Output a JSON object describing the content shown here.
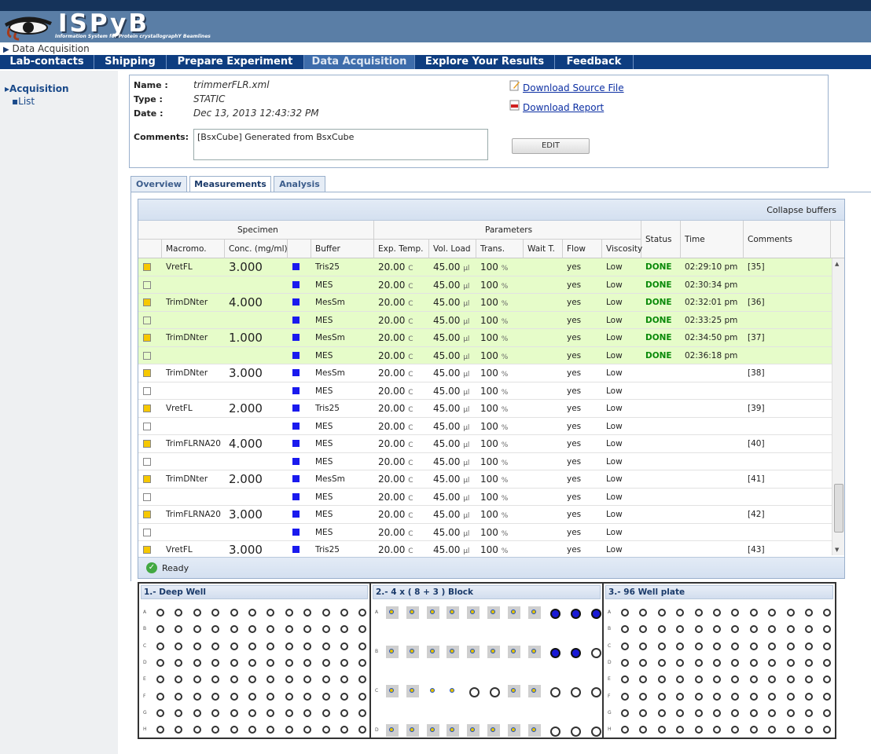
{
  "app": {
    "name": "ISPyB",
    "subtitle": "Information System for Protein crystallographY Beamlines"
  },
  "breadcrumb": "Data Acquisition",
  "nav": [
    "Lab-contacts",
    "Shipping",
    "Prepare Experiment",
    "Data Acquisition",
    "Explore Your Results",
    "Feedback"
  ],
  "nav_active": "Data Acquisition",
  "sidebar": {
    "section": "Acquisition",
    "item": "List"
  },
  "info": {
    "name_label": "Name :",
    "name": "trimmerFLR.xml",
    "type_label": "Type :",
    "type": "STATIC",
    "date_label": "Date :",
    "date": "Dec 13, 2013 12:43:32 PM",
    "comments_label": "Comments:",
    "comments": "[BsxCube] Generated from BsxCube",
    "download_source": "Download Source File",
    "download_report": "Download Report",
    "edit": "EDIT"
  },
  "tabs": [
    "Overview",
    "Measurements",
    "Analysis"
  ],
  "active_tab": "Measurements",
  "grid": {
    "collapse": "Collapse buffers",
    "group_specimen": "Specimen",
    "group_parameters": "Parameters",
    "columns": [
      "Macromo.",
      "Conc. (mg/ml)",
      "Buffer",
      "Exp. Temp.",
      "Vol. Load",
      "Trans.",
      "Wait T.",
      "Flow",
      "Viscosity",
      "Status",
      "Time",
      "Comments"
    ],
    "units": {
      "temp": "C",
      "vol": "µl",
      "trans": "%"
    },
    "rows": [
      {
        "sample": true,
        "macro": "VretFL",
        "conc": "3.000",
        "buffer": "Tris25",
        "temp": "20.00",
        "vol": "45.00",
        "trans": "100",
        "flow": "yes",
        "visc": "Low",
        "status": "DONE",
        "time": "02:29:10 pm",
        "comment": "[35]"
      },
      {
        "sample": false,
        "macro": "",
        "conc": "",
        "buffer": "MES",
        "temp": "20.00",
        "vol": "45.00",
        "trans": "100",
        "flow": "yes",
        "visc": "Low",
        "status": "DONE",
        "time": "02:30:34 pm",
        "comment": ""
      },
      {
        "sample": true,
        "macro": "TrimDNter",
        "conc": "4.000",
        "buffer": "MesSm",
        "temp": "20.00",
        "vol": "45.00",
        "trans": "100",
        "flow": "yes",
        "visc": "Low",
        "status": "DONE",
        "time": "02:32:01 pm",
        "comment": "[36]"
      },
      {
        "sample": false,
        "macro": "",
        "conc": "",
        "buffer": "MES",
        "temp": "20.00",
        "vol": "45.00",
        "trans": "100",
        "flow": "yes",
        "visc": "Low",
        "status": "DONE",
        "time": "02:33:25 pm",
        "comment": ""
      },
      {
        "sample": true,
        "macro": "TrimDNter",
        "conc": "1.000",
        "buffer": "MesSm",
        "temp": "20.00",
        "vol": "45.00",
        "trans": "100",
        "flow": "yes",
        "visc": "Low",
        "status": "DONE",
        "time": "02:34:50 pm",
        "comment": "[37]"
      },
      {
        "sample": false,
        "macro": "",
        "conc": "",
        "buffer": "MES",
        "temp": "20.00",
        "vol": "45.00",
        "trans": "100",
        "flow": "yes",
        "visc": "Low",
        "status": "DONE",
        "time": "02:36:18 pm",
        "comment": ""
      },
      {
        "sample": true,
        "macro": "TrimDNter",
        "conc": "3.000",
        "buffer": "MesSm",
        "temp": "20.00",
        "vol": "45.00",
        "trans": "100",
        "flow": "yes",
        "visc": "Low",
        "status": "",
        "time": "",
        "comment": "[38]"
      },
      {
        "sample": false,
        "macro": "",
        "conc": "",
        "buffer": "MES",
        "temp": "20.00",
        "vol": "45.00",
        "trans": "100",
        "flow": "yes",
        "visc": "Low",
        "status": "",
        "time": "",
        "comment": ""
      },
      {
        "sample": true,
        "macro": "VretFL",
        "conc": "2.000",
        "buffer": "Tris25",
        "temp": "20.00",
        "vol": "45.00",
        "trans": "100",
        "flow": "yes",
        "visc": "Low",
        "status": "",
        "time": "",
        "comment": "[39]"
      },
      {
        "sample": false,
        "macro": "",
        "conc": "",
        "buffer": "MES",
        "temp": "20.00",
        "vol": "45.00",
        "trans": "100",
        "flow": "yes",
        "visc": "Low",
        "status": "",
        "time": "",
        "comment": ""
      },
      {
        "sample": true,
        "macro": "TrimFLRNA20",
        "conc": "4.000",
        "buffer": "MES",
        "temp": "20.00",
        "vol": "45.00",
        "trans": "100",
        "flow": "yes",
        "visc": "Low",
        "status": "",
        "time": "",
        "comment": "[40]"
      },
      {
        "sample": false,
        "macro": "",
        "conc": "",
        "buffer": "MES",
        "temp": "20.00",
        "vol": "45.00",
        "trans": "100",
        "flow": "yes",
        "visc": "Low",
        "status": "",
        "time": "",
        "comment": ""
      },
      {
        "sample": true,
        "macro": "TrimDNter",
        "conc": "2.000",
        "buffer": "MesSm",
        "temp": "20.00",
        "vol": "45.00",
        "trans": "100",
        "flow": "yes",
        "visc": "Low",
        "status": "",
        "time": "",
        "comment": "[41]"
      },
      {
        "sample": false,
        "macro": "",
        "conc": "",
        "buffer": "MES",
        "temp": "20.00",
        "vol": "45.00",
        "trans": "100",
        "flow": "yes",
        "visc": "Low",
        "status": "",
        "time": "",
        "comment": ""
      },
      {
        "sample": true,
        "macro": "TrimFLRNA20",
        "conc": "3.000",
        "buffer": "MES",
        "temp": "20.00",
        "vol": "45.00",
        "trans": "100",
        "flow": "yes",
        "visc": "Low",
        "status": "",
        "time": "",
        "comment": "[42]"
      },
      {
        "sample": false,
        "macro": "",
        "conc": "",
        "buffer": "MES",
        "temp": "20.00",
        "vol": "45.00",
        "trans": "100",
        "flow": "yes",
        "visc": "Low",
        "status": "",
        "time": "",
        "comment": ""
      },
      {
        "sample": true,
        "macro": "VretFL",
        "conc": "3.000",
        "buffer": "Tris25",
        "temp": "20.00",
        "vol": "45.00",
        "trans": "100",
        "flow": "yes",
        "visc": "Low",
        "status": "",
        "time": "",
        "comment": "[43]"
      }
    ],
    "status_text": "Ready"
  },
  "plates": [
    {
      "title": "1.- Deep Well",
      "kind": "round",
      "rows": [
        "A",
        "B",
        "C",
        "D",
        "E",
        "F",
        "G",
        "H"
      ],
      "cols": 12,
      "filled": []
    },
    {
      "title": "2.- 4 x ( 8 + 3 ) Block",
      "kind": "block",
      "rows": [
        "A",
        "B",
        "C",
        "D"
      ],
      "cols": 11,
      "filled": [
        "A9",
        "A10",
        "A11",
        "B9",
        "B10"
      ],
      "squares": [
        "A1",
        "A2",
        "A3",
        "A4",
        "A5",
        "A6",
        "A7",
        "A8",
        "B1",
        "B2",
        "B3",
        "B4",
        "B5",
        "B6",
        "B7",
        "B8",
        "C1",
        "C2",
        "C7",
        "C8",
        "D1",
        "D2",
        "D3",
        "D4",
        "D5",
        "D6",
        "D7",
        "D8"
      ],
      "dots": [
        "A1",
        "A2",
        "A3",
        "A4",
        "A5",
        "A6",
        "A7",
        "A8",
        "B1",
        "B2",
        "B3",
        "B4",
        "B5",
        "B6",
        "B7",
        "B8",
        "C1",
        "C2",
        "C3",
        "C4",
        "C7",
        "C8",
        "D1",
        "D2",
        "D3",
        "D4",
        "D5",
        "D6",
        "D7",
        "D8"
      ]
    },
    {
      "title": "3.- 96 Well plate",
      "kind": "round",
      "rows": [
        "A",
        "B",
        "C",
        "D",
        "E",
        "F",
        "G",
        "H"
      ],
      "cols": 12,
      "filled": []
    }
  ]
}
